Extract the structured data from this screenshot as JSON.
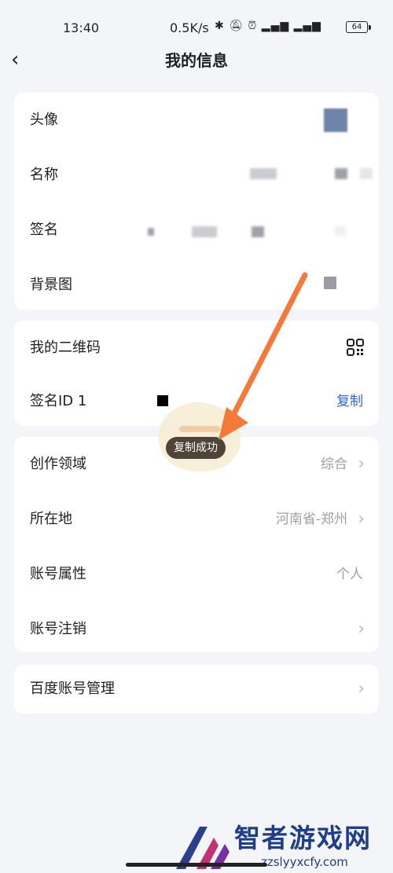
{
  "status_bar": {
    "time": "13:40",
    "network_speed": "0.5K/s",
    "icons": [
      "bluetooth-icon",
      "mute-icon",
      "alarm-icon",
      "hd-icon",
      "signal-4g-icon",
      "hd-icon",
      "signal-5g-icon"
    ],
    "battery": "64"
  },
  "header": {
    "back_glyph": "‹",
    "title": "我的信息"
  },
  "profile_card": {
    "avatar_label": "头像",
    "name_label": "名称",
    "signature_label": "签名",
    "background_label": "背景图"
  },
  "id_card": {
    "qr_label": "我的二维码",
    "signature_id_label": "签名ID 1",
    "copy_label": "复制"
  },
  "details_card": {
    "field_label": "创作领域",
    "field_value": "综合",
    "location_label": "所在地",
    "location_value": "河南省-郑州",
    "account_type_label": "账号属性",
    "account_type_value": "个人",
    "deactivate_label": "账号注销"
  },
  "baidu_card": {
    "label": "百度账号管理"
  },
  "toast": {
    "text": "复制成功"
  },
  "annotation": {
    "arrow_color": "#f47a3a"
  },
  "watermark": {
    "title": "智者游戏网",
    "url": "zzslyyxcfy.com"
  },
  "colors": {
    "background": "#f3f5f8",
    "card": "#ffffff",
    "accent_link": "#2f63d8",
    "secondary_text": "#9a9ea6"
  }
}
